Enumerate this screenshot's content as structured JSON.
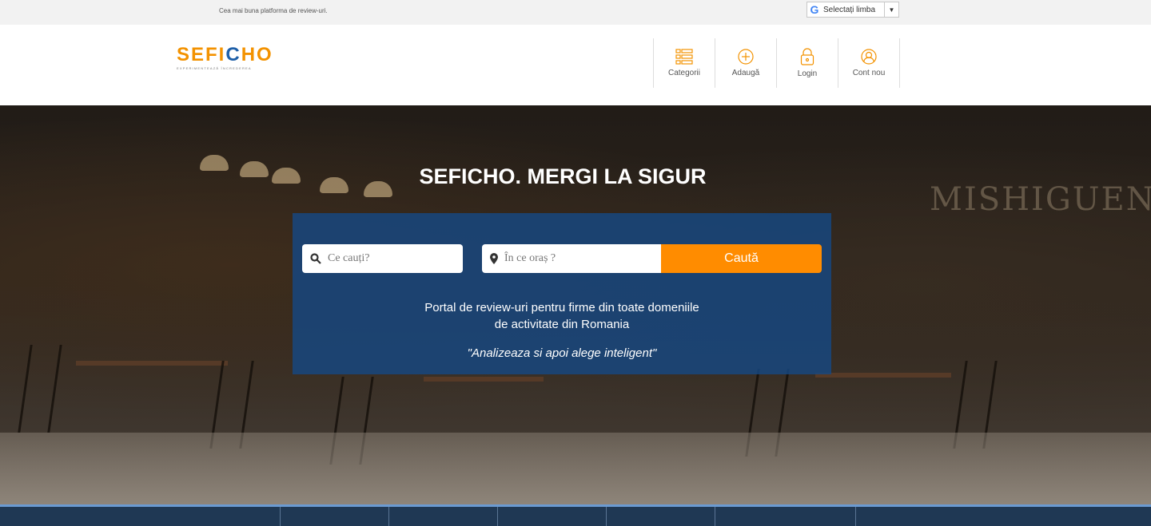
{
  "topbar": {
    "tagline": "Cea mai buna platforma de review-uri.",
    "language_label": "Selectați limba",
    "language_arrow": "▼"
  },
  "header": {
    "logo_text_left": "SEFI",
    "logo_text_c": "C",
    "logo_text_right": "HO",
    "logo_subtitle": "EXPERIMENTEAZĂ ÎNCREDEREA",
    "nav": [
      {
        "label": "Categorii",
        "icon": "list-icon"
      },
      {
        "label": "Adaugă",
        "icon": "plus-circle-icon"
      },
      {
        "label": "Login",
        "icon": "lock-icon"
      },
      {
        "label": "Cont nou",
        "icon": "user-icon"
      }
    ]
  },
  "hero": {
    "title": "SEFICHO. MERGI LA SIGUR",
    "search": {
      "what_placeholder": "Ce cauți?",
      "where_placeholder": "În ce oraș ?",
      "button_label": "Caută"
    },
    "description_line1": "Portal de review-uri pentru firme din toate domeniile",
    "description_line2": "de activitate din Romania",
    "quote": "\"Analizeaza si apoi alege inteligent\""
  },
  "colors": {
    "accent": "#ff8c00",
    "brand_blue": "#1e5fa8",
    "search_panel": "#164882",
    "bottom_bar": "#1f3854"
  }
}
